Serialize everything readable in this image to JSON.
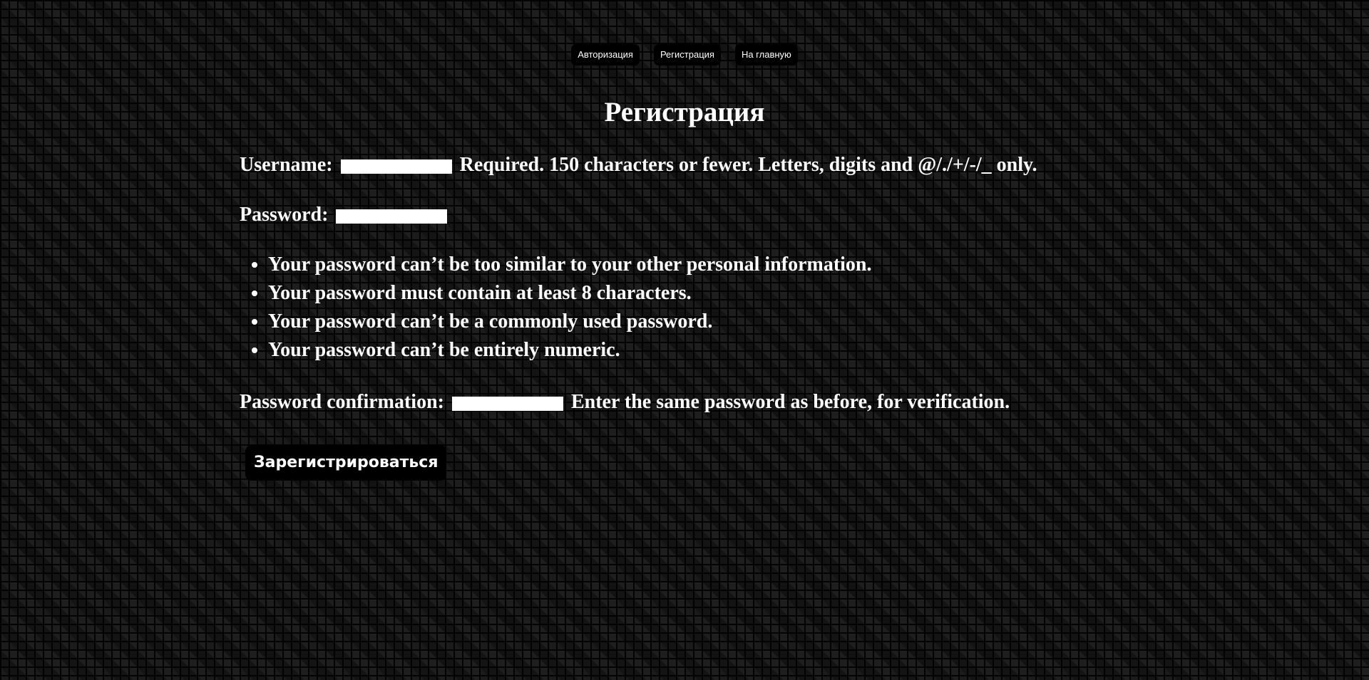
{
  "nav": {
    "links": [
      {
        "label": "Авторизация"
      },
      {
        "label": "Регистрация"
      },
      {
        "label": "На главную"
      }
    ]
  },
  "page_title": "Регистрация",
  "form": {
    "username": {
      "label": "Username:",
      "value": "",
      "help": "Required. 150 characters or fewer. Letters, digits and @/./+/-/_ only."
    },
    "password": {
      "label": "Password:",
      "value": "",
      "rules": [
        "Your password can’t be too similar to your other personal information.",
        "Your password must contain at least 8 characters.",
        "Your password can’t be a commonly used password.",
        "Your password can’t be entirely numeric."
      ]
    },
    "password_confirmation": {
      "label": "Password confirmation:",
      "value": "",
      "help": "Enter the same password as before, for verification."
    },
    "submit_label": "Зарегистрироваться"
  },
  "colors": {
    "background": "#0c0c0c",
    "text": "#ffffff",
    "button_background": "#000000",
    "field_background": "#ffffff"
  }
}
